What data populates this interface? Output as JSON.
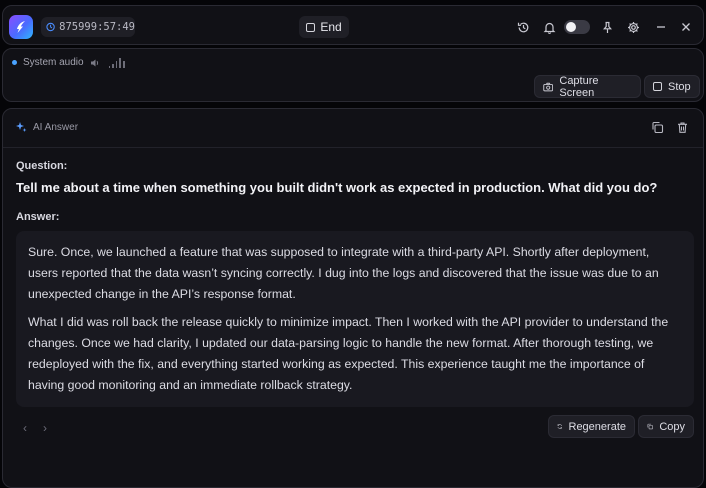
{
  "topbar": {
    "timer": "875999:57:49",
    "end_label": "End",
    "icons": [
      "history-icon",
      "bell-icon",
      "toggle",
      "pin-icon",
      "gear-icon",
      "minimize-icon",
      "close-icon"
    ],
    "toggle_on": false
  },
  "audio": {
    "source_label": "System audio",
    "capture_label": "Capture Screen",
    "stop_label": "Stop",
    "indicator_color": "#4aa3ff"
  },
  "answer": {
    "header_label": "AI Answer",
    "question_label": "Question:",
    "question_text": "Tell me about a time when something you built didn't work as expected in production. What did you do?",
    "answer_label": "Answer:",
    "answer_paragraphs": [
      "Sure. Once, we launched a feature that was supposed to integrate with a third-party API. Shortly after deployment, users reported that the data wasn’t syncing correctly. I dug into the logs and discovered that the issue was due to an unexpected change in the API’s response format.",
      "What I did was roll back the release quickly to minimize impact. Then I worked with the API provider to understand the changes. Once we had clarity, I updated our data-parsing logic to handle the new format. After thorough testing, we redeployed with the fix, and everything started working as expected. This experience taught me the importance of having good monitoring and an immediate rollback strategy."
    ],
    "prev_glyph": "‹",
    "next_glyph": "›",
    "regenerate_label": "Regenerate",
    "copy_label": "Copy"
  }
}
